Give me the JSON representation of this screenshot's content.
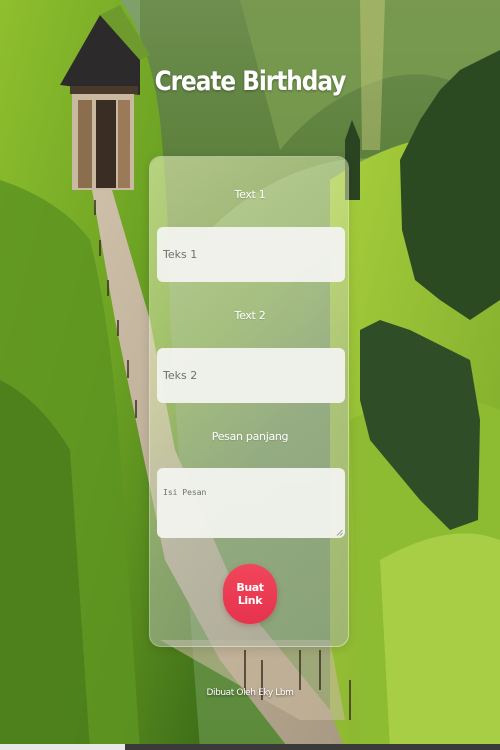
{
  "page": {
    "title": "Create Birthday"
  },
  "form": {
    "field1": {
      "label": "Text 1",
      "placeholder": "Teks 1"
    },
    "field2": {
      "label": "Text 2",
      "placeholder": "Teks 2"
    },
    "message": {
      "label": "Pesan panjang",
      "placeholder": "Isi Pesan"
    },
    "submit_label": "Buat Link"
  },
  "footer": {
    "credit": "Dibuat Oleh Eky Lbm"
  },
  "colors": {
    "accent": "#e6324e",
    "title_text": "#ffffff",
    "input_bg": "#f2f3ef"
  }
}
